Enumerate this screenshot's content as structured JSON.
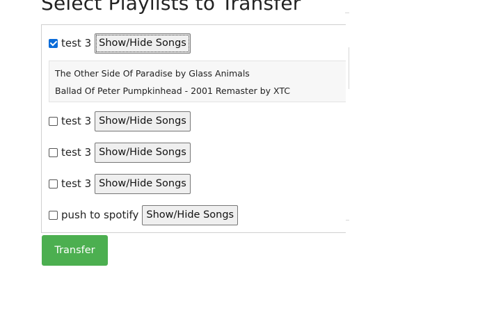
{
  "page": {
    "title": "Select Playlists to Transfer"
  },
  "playlists": [
    {
      "name": "test 3",
      "checked": true,
      "button_label": "Show/Hide Songs",
      "songs": [
        "The Other Side Of Paradise by Glass Animals",
        "Ballad Of Peter Pumpkinhead - 2001 Remaster by XTC"
      ]
    },
    {
      "name": "test 3",
      "checked": false,
      "button_label": "Show/Hide Songs"
    },
    {
      "name": "test 3",
      "checked": false,
      "button_label": "Show/Hide Songs"
    },
    {
      "name": "test 3",
      "checked": false,
      "button_label": "Show/Hide Songs"
    },
    {
      "name": "push to spotify",
      "checked": false,
      "button_label": "Show/Hide Songs"
    }
  ],
  "actions": {
    "transfer_label": "Transfer"
  },
  "colors": {
    "transfer_button": "#4caf50",
    "checkbox_checked": "#0b6cd9"
  }
}
